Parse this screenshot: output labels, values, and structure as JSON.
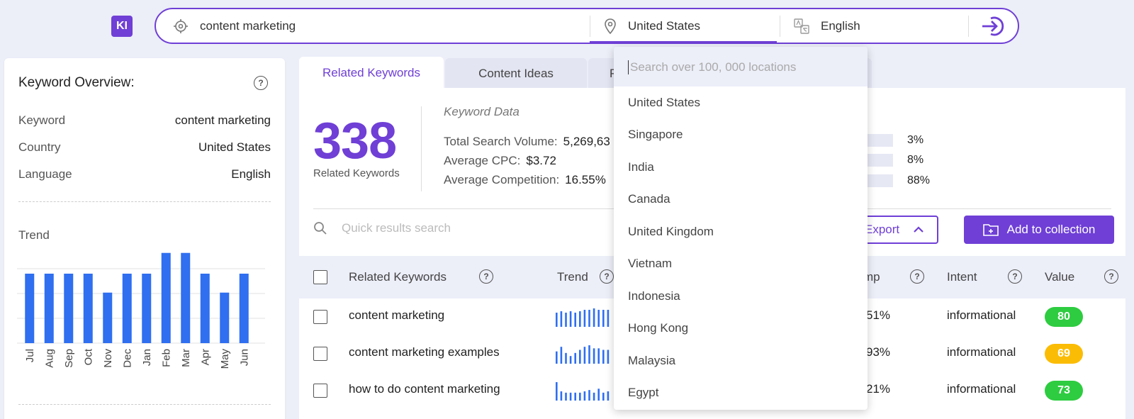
{
  "app": {
    "logo": "KI"
  },
  "search": {
    "keyword": "content marketing",
    "country": "United States",
    "language": "English"
  },
  "overview": {
    "title": "Keyword Overview:",
    "help": "?",
    "rows": [
      {
        "label": "Keyword",
        "value": "content marketing"
      },
      {
        "label": "Country",
        "value": "United States"
      },
      {
        "label": "Language",
        "value": "English"
      }
    ],
    "trend_label": "Trend"
  },
  "chart_data": {
    "type": "bar",
    "categories": [
      "Jul",
      "Aug",
      "Sep",
      "Oct",
      "Nov",
      "Dec",
      "Jan",
      "Feb",
      "Mar",
      "Apr",
      "May",
      "Jun"
    ],
    "values": [
      77,
      77,
      77,
      77,
      56,
      77,
      77,
      100,
      100,
      77,
      56,
      77
    ],
    "ylim": [
      0,
      110
    ],
    "grid": true,
    "color": "#2f6ff0"
  },
  "tabs": [
    {
      "label": "Related Keywords",
      "active": true
    },
    {
      "label": "Content Ideas",
      "active": false
    },
    {
      "label": "P",
      "active": false
    }
  ],
  "summary": {
    "count": "338",
    "count_label": "Related Keywords",
    "data_title": "Keyword Data",
    "rows": [
      {
        "label": "Total Search Volume:",
        "value": "5,269,63"
      },
      {
        "label": "Average CPC:",
        "value": "$3.72"
      },
      {
        "label": "Average Competition:",
        "value": "16.55%"
      }
    ],
    "bars": [
      {
        "value": "3%",
        "fill": 0
      },
      {
        "value": "8%",
        "fill": 0
      },
      {
        "value": "88%",
        "fill": 0.38
      }
    ]
  },
  "toolbar": {
    "quick_search_placeholder": "Quick results search",
    "export_label": "Export",
    "add_label": "Add to collection"
  },
  "table": {
    "headers": {
      "keyword": "Related Keywords",
      "trend": "Trend",
      "comp": "mp",
      "intent": "Intent",
      "value": "Value"
    },
    "rows": [
      {
        "keyword": "content marketing",
        "comp": "51%",
        "intent": "informational",
        "value": "80",
        "color": "#2ecc40",
        "spark": [
          10,
          11,
          10,
          11,
          10,
          11,
          12,
          12,
          13,
          12,
          12,
          12
        ]
      },
      {
        "keyword": "content marketing examples",
        "comp": "93%",
        "intent": "informational",
        "value": "69",
        "color": "#fbbc05",
        "spark": [
          8,
          11,
          7,
          5,
          7,
          9,
          11,
          12,
          10,
          10,
          9,
          9
        ]
      },
      {
        "keyword": "how to do content marketing",
        "comp": "21%",
        "intent": "informational",
        "value": "73",
        "color": "#2ecc40",
        "spark": [
          14,
          7,
          6,
          6,
          6,
          6,
          7,
          8,
          6,
          9,
          6,
          7
        ]
      }
    ]
  },
  "dropdown": {
    "placeholder": "Search over 100, 000 locations",
    "items": [
      "United States",
      "Singapore",
      "India",
      "Canada",
      "United Kingdom",
      "Vietnam",
      "Indonesia",
      "Hong Kong",
      "Malaysia",
      "Egypt"
    ]
  }
}
